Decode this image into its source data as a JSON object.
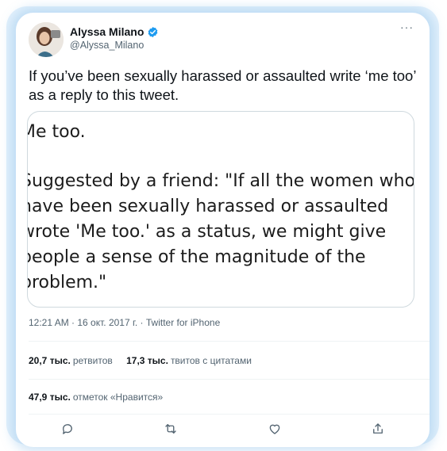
{
  "tweet": {
    "author_name": "Alyssa Milano",
    "handle": "@Alyssa_Milano",
    "more_label": "···",
    "text": "If you’ve been sexually harassed or assaulted write ‘me too’ as a reply to this tweet.",
    "embed_lines": [
      "Me too.",
      "Suggested by a friend: \"If all the women who",
      "have been sexually harassed or assaulted",
      "wrote 'Me too.' as a status, we might give",
      "people a sense of the magnitude of the",
      "problem.\""
    ],
    "timestamp": "12:21 AM · 16 окт. 2017 г. · Twitter for iPhone"
  },
  "stats": {
    "retweets_count": "20,7 тыс.",
    "retweets_label": "ретвитов",
    "quotes_count": "17,3 тыс.",
    "quotes_label": "твитов с цитатами",
    "likes_count": "47,9 тыс.",
    "likes_label": "отметок «Нравится»"
  },
  "actions": {
    "icons": [
      "reply-icon",
      "retweet-icon",
      "like-icon",
      "share-icon"
    ]
  },
  "colors": {
    "verified": "#1d9bf0",
    "secondary_text": "#536471",
    "border": "#cfd9de",
    "frame_glow": "#e3f1fc"
  }
}
